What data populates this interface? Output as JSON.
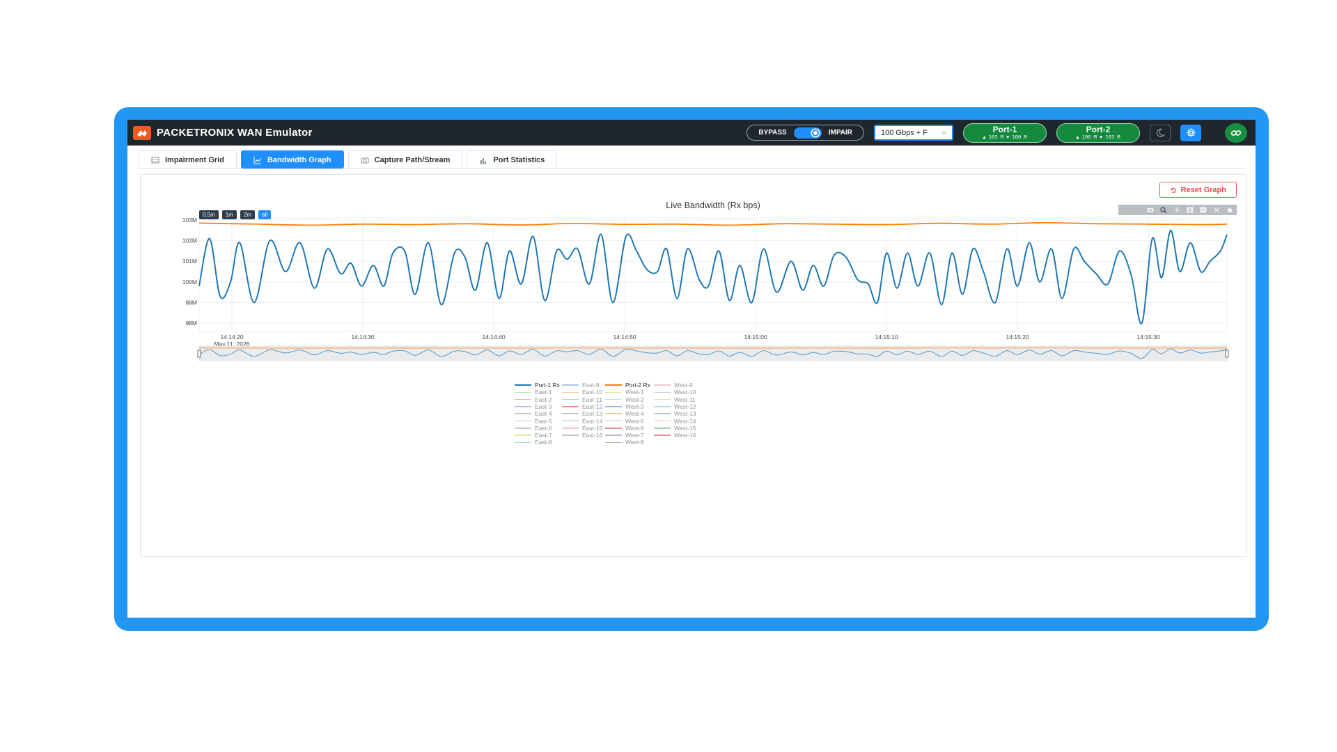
{
  "header": {
    "brand": "PACKETRONIX WAN Emulator",
    "bypass_label": "BYPASS",
    "impair_label": "IMPAIR",
    "speed_value": "100 Gbps + F",
    "port1": {
      "name": "Port-1",
      "rates": "▲ 103 M ▼ 100 M"
    },
    "port2": {
      "name": "Port-2",
      "rates": "▲ 100 M ▼ 103 M"
    },
    "icons": [
      "moon-icon",
      "gear-icon",
      "link-icon"
    ]
  },
  "tabs": [
    {
      "label": "Impairment Grid",
      "icon": "table-icon"
    },
    {
      "label": "Bandwidth Graph",
      "icon": "chart-icon",
      "active": true
    },
    {
      "label": "Capture Path/Stream",
      "icon": "camera-icon"
    },
    {
      "label": "Port Statistics",
      "icon": "bar-icon"
    }
  ],
  "reset_label": "Reset Graph",
  "range_buttons": [
    "0.5m",
    "1m",
    "2m",
    "all"
  ],
  "chart_data": {
    "type": "line",
    "title": "Live Bandwidth (Rx bps)",
    "ylim": [
      97.6,
      103.1
    ],
    "yticks": [
      {
        "v": 98,
        "label": "98M"
      },
      {
        "v": 99,
        "label": "99M"
      },
      {
        "v": 100,
        "label": "100M"
      },
      {
        "v": 101,
        "label": "101M"
      },
      {
        "v": 102,
        "label": "102M"
      },
      {
        "v": 103,
        "label": "103M"
      }
    ],
    "xrange": [
      "14:14:17.5",
      "14:15:36"
    ],
    "xticks": [
      {
        "t": 20,
        "label": "14:14:20",
        "sub": "May 11, 2026"
      },
      {
        "t": 30,
        "label": "14:14:30"
      },
      {
        "t": 40,
        "label": "14:14:40"
      },
      {
        "t": 50,
        "label": "14:14:50"
      },
      {
        "t": 60,
        "label": "14:15:00"
      },
      {
        "t": 70,
        "label": "14:15:10"
      },
      {
        "t": 80,
        "label": "14:15:20"
      },
      {
        "t": 90,
        "label": "14:15:30"
      }
    ],
    "grid": true,
    "rangeslider": true,
    "series": [
      {
        "name": "Port-1 Rx",
        "color": "#1f77b4",
        "x": [
          17.5,
          18.3,
          19.1,
          19.9,
          20.6,
          21.7,
          22.9,
          24.1,
          25.2,
          26.3,
          27.3,
          28.3,
          29.1,
          29.9,
          30.8,
          31.6,
          32.3,
          33.2,
          34.0,
          35.0,
          36.0,
          37.0,
          37.8,
          38.6,
          39.5,
          40.4,
          41.2,
          42.1,
          43.0,
          43.9,
          44.8,
          45.6,
          46.4,
          47.3,
          48.2,
          49.1,
          50.1,
          50.9,
          51.7,
          52.5,
          53.2,
          54.0,
          54.8,
          55.7,
          56.4,
          57.2,
          58.0,
          58.8,
          59.7,
          60.6,
          61.6,
          62.7,
          63.6,
          64.4,
          65.2,
          66.0,
          66.9,
          67.8,
          68.6,
          69.3,
          70.0,
          70.8,
          71.6,
          72.4,
          73.3,
          74.2,
          75.0,
          75.8,
          76.6,
          77.4,
          78.3,
          79.2,
          80.0,
          80.9,
          81.7,
          82.6,
          83.4,
          84.3,
          85.1,
          86.0,
          86.9,
          87.8,
          88.7,
          89.5,
          90.3,
          91.0,
          91.7,
          92.4,
          93.2,
          94.0,
          94.7,
          95.5,
          96.0
        ],
        "y": [
          99.8,
          102.1,
          99.3,
          100.0,
          101.9,
          99.0,
          102.0,
          100.5,
          101.9,
          99.7,
          101.6,
          100.4,
          100.9,
          99.8,
          100.8,
          99.8,
          101.4,
          101.5,
          99.4,
          101.9,
          98.9,
          101.4,
          101.2,
          99.6,
          101.9,
          99.2,
          101.5,
          99.9,
          102.2,
          99.1,
          101.5,
          101.1,
          101.6,
          99.9,
          102.3,
          99.0,
          102.2,
          101.5,
          100.6,
          100.5,
          101.6,
          99.2,
          101.6,
          100.1,
          99.8,
          101.5,
          99.1,
          100.8,
          99.0,
          101.6,
          99.5,
          101.0,
          99.6,
          100.8,
          99.8,
          101.3,
          101.2,
          100.1,
          99.9,
          99.0,
          101.4,
          99.7,
          101.4,
          99.8,
          101.4,
          98.9,
          101.4,
          99.4,
          101.6,
          100.5,
          99.0,
          101.6,
          99.8,
          101.9,
          100.0,
          101.6,
          99.2,
          101.6,
          101.0,
          100.4,
          99.9,
          101.5,
          100.3,
          98.0,
          102.1,
          100.2,
          102.5,
          100.5,
          101.9,
          100.5,
          101.0,
          101.5,
          102.3
        ],
        "comment_fix": null
      },
      {
        "name": "Port-2 Rx",
        "color": "#ff7f0e",
        "x": [
          17.5,
          22,
          26,
          30,
          34,
          38,
          42,
          46,
          50,
          54,
          58,
          62,
          66,
          70,
          74,
          78,
          82,
          86,
          90,
          94,
          96
        ],
        "y": [
          102.85,
          102.8,
          102.75,
          102.8,
          102.78,
          102.82,
          102.76,
          102.83,
          102.79,
          102.8,
          102.75,
          102.82,
          102.8,
          102.78,
          102.84,
          102.8,
          102.87,
          102.82,
          102.8,
          102.78,
          102.8
        ]
      }
    ],
    "legend": {
      "placement": "bottom-center",
      "columns": [
        [
          {
            "name": "Port-1 Rx",
            "color": "#1f77b4",
            "main": true
          },
          {
            "name": "East-1",
            "color": "#c7d9ae"
          },
          {
            "name": "East-2",
            "color": "#f2a2a2"
          },
          {
            "name": "East-3",
            "color": "#c6b6d8"
          },
          {
            "name": "East-4",
            "color": "#d8bfc0"
          },
          {
            "name": "East-5",
            "color": "#e2bdd6"
          },
          {
            "name": "East-6",
            "color": "#c5c8cc"
          },
          {
            "name": "East-7",
            "color": "#e4e3a6"
          },
          {
            "name": "East-8",
            "color": "#a8dde0"
          }
        ],
        [
          {
            "name": "East-9",
            "color": "#a9c7e3"
          },
          {
            "name": "East-10",
            "color": "#f6c79b"
          },
          {
            "name": "East-11",
            "color": "#a8d6a2"
          },
          {
            "name": "East-12",
            "color": "#ee8f8f"
          },
          {
            "name": "East-13",
            "color": "#c8c4cc"
          },
          {
            "name": "East-14",
            "color": "#c7b9a8"
          },
          {
            "name": "East-15",
            "color": "#f0c0dc"
          },
          {
            "name": "East-16",
            "color": "#c7c7c7"
          }
        ],
        [
          {
            "name": "Port-2 Rx",
            "color": "#ff7f0e",
            "main": true
          },
          {
            "name": "West-1",
            "color": "#e7e1a4"
          },
          {
            "name": "West-2",
            "color": "#a9dbe2"
          },
          {
            "name": "West-3",
            "color": "#9fb8d8"
          },
          {
            "name": "West-4",
            "color": "#f5c99e"
          },
          {
            "name": "West-5",
            "color": "#b8d8a5"
          },
          {
            "name": "West-6",
            "color": "#ec9494"
          },
          {
            "name": "West-7",
            "color": "#c6b5d8"
          },
          {
            "name": "West-8",
            "color": "#c9b5a6"
          }
        ],
        [
          {
            "name": "West-9",
            "color": "#efc3dc"
          },
          {
            "name": "West-10",
            "color": "#c9c9c9"
          },
          {
            "name": "West-11",
            "color": "#e3e2a5"
          },
          {
            "name": "West-12",
            "color": "#a9dbe2"
          },
          {
            "name": "West-13",
            "color": "#a9c8e6"
          },
          {
            "name": "West-14",
            "color": "#f6c79b"
          },
          {
            "name": "West-15",
            "color": "#a3d6a0"
          },
          {
            "name": "West-16",
            "color": "#ef9090"
          }
        ]
      ]
    }
  }
}
